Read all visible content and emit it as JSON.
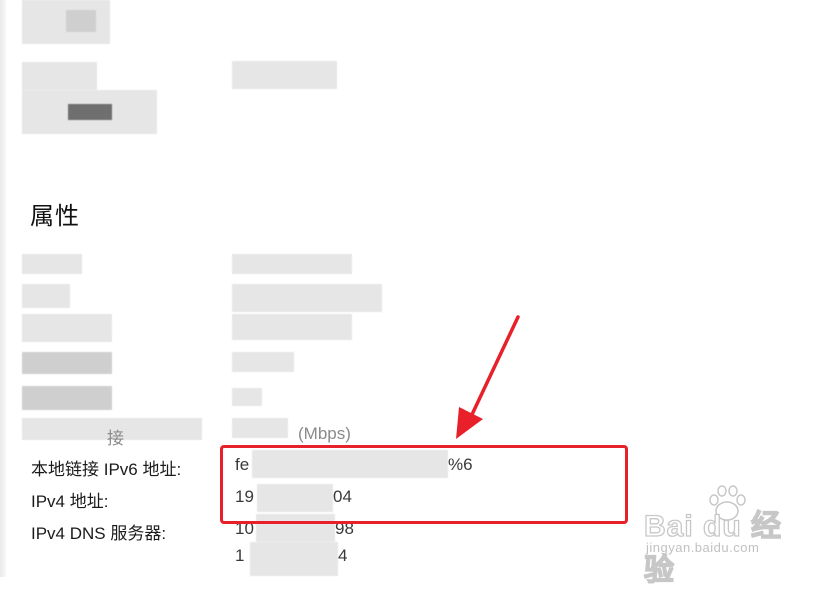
{
  "section": {
    "title": "属性"
  },
  "properties": [
    {
      "label": "本地链接 IPv6 地址:",
      "value_start": "fe",
      "value_end": "%6"
    },
    {
      "label": "IPv4 地址:",
      "value_start": "19",
      "value_end": "04"
    },
    {
      "label": "IPv4 DNS 服务器:",
      "value_start": "10",
      "value_end": "98"
    }
  ],
  "dns_second": {
    "value_start": "1",
    "value_end": "4"
  },
  "partial_row": {
    "label": "接",
    "value": "(Mbps)"
  },
  "watermark": {
    "logo": "Bai du 经验",
    "url": "jingyan.baidu.com"
  },
  "colors": {
    "highlight": "#e8202a",
    "arrow": "#e8202a"
  },
  "icons": {
    "arrow": "red-arrow-icon",
    "paw": "baidu-paw-icon"
  }
}
